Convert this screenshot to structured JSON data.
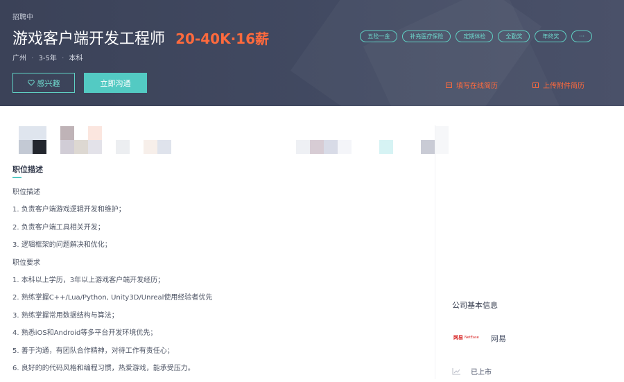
{
  "header": {
    "status": "招聘中",
    "job_title": "游戏客户端开发工程师",
    "salary": "20-40K·16薪",
    "city": "广州",
    "experience": "3-5年",
    "degree": "本科",
    "separator": "·",
    "tags": [
      "五险一金",
      "补充医疗保险",
      "定期体检",
      "全勤奖",
      "年终奖",
      "···"
    ],
    "interest_button": "感兴趣",
    "chat_button": "立即沟通",
    "online_resume_link": "填写在线简历",
    "attach_resume_link": "上传附件简历"
  },
  "job": {
    "section_title": "职位描述",
    "lines": [
      "职位描述",
      "1. 负责客户端游戏逻辑开发和维护；",
      "2. 负责客户端工具相关开发；",
      "3. 逻辑框架的问题解决和优化；",
      "职位要求",
      "1. 本科以上学历，3年以上游戏客户端开发经历；",
      "2. 熟练掌握C++/Lua/Python, Unity3D/Unreal使用经验者优先",
      "3. 熟练掌握常用数据结构与算法；",
      "4. 熟悉iOS和Android等多平台开发环境优先；",
      "5. 善于沟通，有团队合作精神，对待工作有责任心；",
      "6. 良好的的代码风格和编程习惯，热爱游戏，能承受压力。"
    ]
  },
  "company": {
    "heading": "公司基本信息",
    "logo_cn": "网易",
    "logo_en": "NetEase",
    "name": "网易",
    "listed": "已上市"
  },
  "colors": {
    "banner": "#424a62",
    "accent": "#53cac3",
    "salary": "#ff6a3d"
  },
  "icons": {
    "interest": "heart-icon",
    "online_resume": "resume-form-icon",
    "attach_resume": "upload-icon",
    "listed": "chart-icon"
  }
}
